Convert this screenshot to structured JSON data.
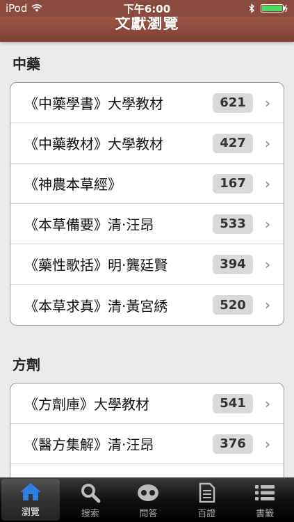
{
  "status": {
    "carrier": "iPod",
    "time": "下午6:00"
  },
  "nav": {
    "title": "文獻瀏覽"
  },
  "sections": [
    {
      "title": "中藥",
      "items": [
        {
          "label": "《中藥學書》大學教材",
          "count": "621"
        },
        {
          "label": "《中藥教材》大學教材",
          "count": "427"
        },
        {
          "label": "《神農本草經》",
          "count": "167"
        },
        {
          "label": "《本草備要》清·汪昂",
          "count": "533"
        },
        {
          "label": "《藥性歌括》明·龔廷賢",
          "count": "394"
        },
        {
          "label": "《本草求真》清·黃宮綉",
          "count": "520"
        }
      ]
    },
    {
      "title": "方劑",
      "items": [
        {
          "label": "《方劑庫》大學教材",
          "count": "541"
        },
        {
          "label": "《醫方集解》清·汪昂",
          "count": "376"
        }
      ]
    }
  ],
  "tabs": [
    {
      "label": "瀏覽",
      "icon": "home-icon"
    },
    {
      "label": "搜索",
      "icon": "search-icon"
    },
    {
      "label": "問答",
      "icon": "qa-icon"
    },
    {
      "label": "百證",
      "icon": "document-icon"
    },
    {
      "label": "書籤",
      "icon": "list-icon"
    }
  ],
  "colors": {
    "navbar": "#9a5445",
    "background": "#eaeaea",
    "badge": "#d9d9d9"
  }
}
